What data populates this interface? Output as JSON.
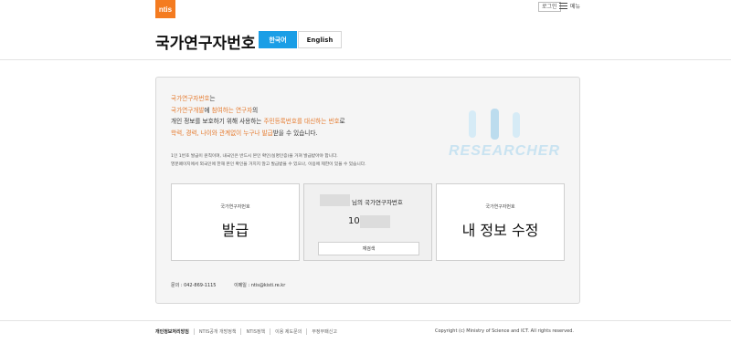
{
  "header": {
    "logo_text": "ntis",
    "login_label": "로그인",
    "menu_label": "메뉴",
    "title": "국가연구자번호",
    "lang_ko": "한국어",
    "lang_en": "English"
  },
  "intro": {
    "line1_a": "국가연구자번호",
    "line1_b": "는",
    "line2_a": "국가연구개발",
    "line2_b": "에 ",
    "line2_c": "참여하는 연구자",
    "line2_d": "의",
    "line3_a": "개인 정보를 보호하기 위해 사용하는 ",
    "line3_b": "주민등록번호를 대신하는 번호",
    "line3_c": "로",
    "line4_a": "학력, 경력, 나이와 관계없이 누구나 발급",
    "line4_b": "받을 수 있습니다."
  },
  "notice": {
    "line1": "1인 1번호 발급이 원칙이며, 내국인은 반드시 본인 확인(실명인증)을 거쳐 발급받아야 합니다.",
    "line2": "영문페이지에서 외국인에 한해 본인 확인을 거치지 않고 발급받을 수 있으나, 이용에 제한이 있을 수 있습니다."
  },
  "watermark": "RESEARCHER",
  "cards": {
    "issue": {
      "small": "국가연구자번호",
      "big": "발급"
    },
    "mine": {
      "title_suffix": "님의 국가연구자번호",
      "id_prefix": "10",
      "reissue_label": "재검색"
    },
    "edit": {
      "small": "국가연구자번호",
      "big": "내 정보 수정"
    }
  },
  "contact": {
    "phone": "문의 : 042-869-1115",
    "email": "이메일 : ntis@kisti.re.kr"
  },
  "footer": {
    "links": [
      "개인정보처리방침",
      "NTIS공개 개방정책",
      "NTIS정책",
      "이용 제도문의",
      "부정부패신고"
    ],
    "copyright": "Copyright (c) Ministry of Science and ICT. All rights reserved."
  },
  "colors": {
    "accent_orange": "#f47b20",
    "accent_blue": "#1a9ee6"
  }
}
